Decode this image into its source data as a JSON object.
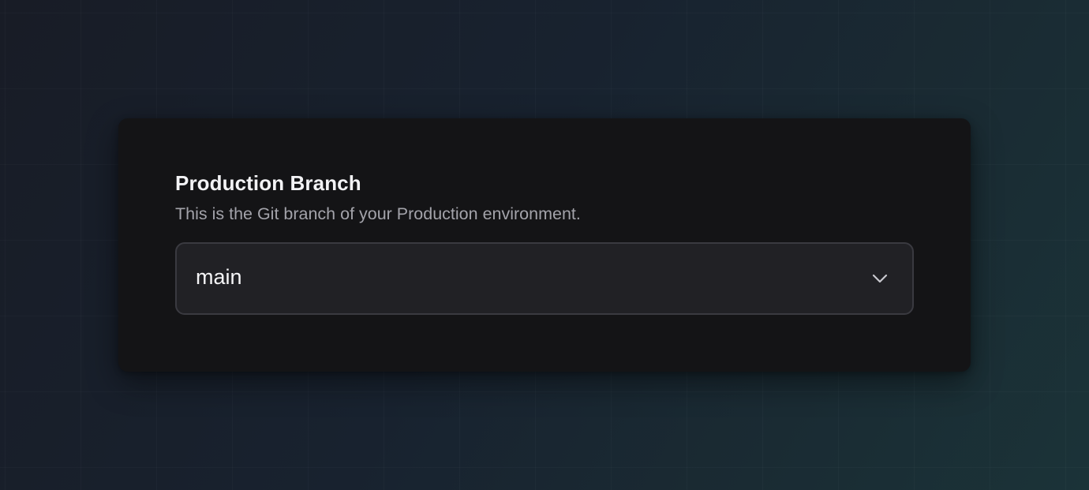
{
  "setting": {
    "label": "Production Branch",
    "description": "This is the Git branch of your Production environment.",
    "branch_select": {
      "selected_value": "main",
      "icon": "chevron-down-icon"
    }
  },
  "colors": {
    "card_background": "#141416",
    "select_background": "#212125",
    "select_border": "#3a3a40",
    "label_text": "#f3f3f5",
    "description_text": "#a3a3aa"
  }
}
